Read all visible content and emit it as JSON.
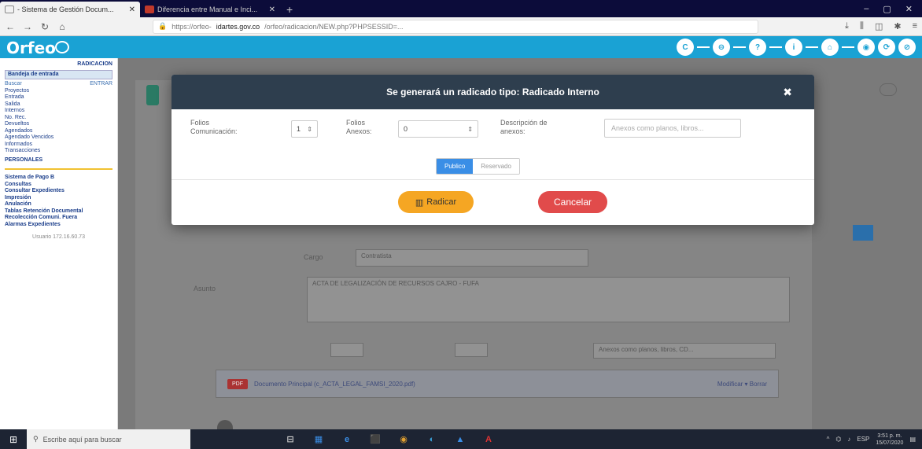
{
  "browser": {
    "tabs": [
      {
        "title": "- Sistema de Gestión Docum...",
        "active": true
      },
      {
        "title": "Diferencia entre Manual e Inci...",
        "active": false
      }
    ],
    "new_tab": "+",
    "url_prefix": "https://orfeo-",
    "url_domain": "idartes.gov.co",
    "url_rest": "/orfeo/radicacion/NEW.php?PHPSESSID=...",
    "window_controls": [
      "–",
      "▢",
      "✕"
    ]
  },
  "app": {
    "logo": "Orfeo",
    "header_icons": [
      "C",
      "⊖",
      "?",
      "i",
      "⌂",
      "◉",
      "⟳",
      "⊘"
    ]
  },
  "sidebar": {
    "section_title": "RADICACION",
    "entry_button": "Bandeja de entrada",
    "search_row": [
      "Buscar",
      "ENTRAR"
    ],
    "items": [
      "Proyectos",
      "Entrada",
      "Salida",
      "Internos",
      "No. Rec.",
      "Devueltos",
      "Agendados",
      "Agendado Vencidos",
      "Informados",
      "Transacciones"
    ],
    "bold_item": "PERSONALES",
    "items2": [
      "Sistema de Pago B",
      "Consultas",
      "Consultar Expedientes",
      "Impresión",
      "Anulación",
      "Tablas Retención Documental",
      "Recolección Comuni. Fuera",
      "Alarmas Expedientes"
    ],
    "footer": "Usuario 172.16.60.73"
  },
  "modal": {
    "title": "Se generará un radicado tipo: Radicado Interno",
    "close": "✖",
    "folios_comunicacion_label": "Folios Comunicación:",
    "folios_comunicacion_value": "1",
    "folios_anexos_label": "Folios Anexos:",
    "folios_anexos_value": "0",
    "descripcion_label": "Descripción de anexos:",
    "descripcion_placeholder": "Anexos como planos, libros...",
    "toggle_on": "Publico",
    "toggle_off": "Reservado",
    "radicar_label": "Radicar",
    "cancelar_label": "Cancelar"
  },
  "background": {
    "cargo_label": "Cargo",
    "cargo_value": "Contratista",
    "asunto_label": "Asunto",
    "asunto_value": "ACTA DE LEGALIZACIÓN DE RECURSOS CAJRO - FUFA",
    "anexos_placeholder": "Anexos como planos, libros, CD...",
    "doc_badge": "PDF",
    "doc_name": "Documento Principal (c_ACTA_LEGAL_FAMSI_2020.pdf)",
    "doc_actions": "Modificar ▾ Borrar"
  },
  "taskbar": {
    "search_placeholder": "Escribe aquí para buscar",
    "apps": [
      "⊟",
      "▦",
      "e",
      "⬛",
      "◉",
      "◐",
      "▲",
      "A"
    ],
    "time": "3:51 p. m.",
    "date": "15/07/2020",
    "lang": "ESP"
  }
}
